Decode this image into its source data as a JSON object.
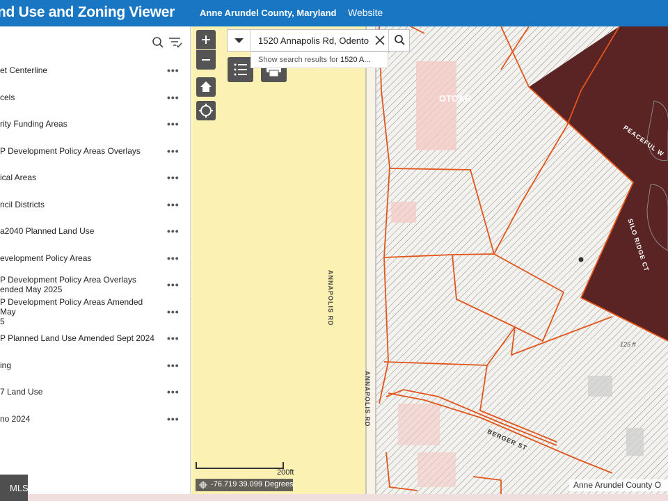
{
  "header": {
    "title": "nd Use and Zoning Viewer",
    "county": "Anne Arundel County, Maryland",
    "website": "Website"
  },
  "layers": [
    {
      "label": "et Centerline"
    },
    {
      "label": "cels"
    },
    {
      "label": "rity Funding Areas"
    },
    {
      "label": "P Development Policy Areas Overlays"
    },
    {
      "label": "ical Areas"
    },
    {
      "label": "ncil Districts"
    },
    {
      "label": "a2040 Planned Land Use"
    },
    {
      "label": "evelopment Policy Areas"
    },
    {
      "label": "P Development Policy Area Overlays\nended May 2025"
    },
    {
      "label": "P Development Policy Areas Amended May\n5"
    },
    {
      "label": "P Planned Land Use Amended Sept 2024"
    },
    {
      "label": "ing"
    },
    {
      "label": "7 Land Use"
    },
    {
      "label": "no 2024"
    }
  ],
  "more_label": "•••",
  "search": {
    "value": "1520 Annapolis Rd, Odento",
    "suggest_prefix": "Show search results for ",
    "suggest_term": "1520 A..."
  },
  "map": {
    "road_labels": [
      "ANNAPOLIS RD",
      "ANNAPOLIS RD",
      "BERGER ST",
      "SILO RIDGE CT",
      "PEACEFUL W"
    ],
    "dimension_label": "125 ft",
    "building_label": "OTCAR"
  },
  "scale_label": "200ft",
  "coordinates": "-76.719 39.099 Degrees",
  "attribution": "Anne Arundel County O",
  "mls_badge": "MLS",
  "colors": {
    "header": "#1876c3",
    "parcel_line": "#e2561c",
    "yellow_zone": "#fbf1b3",
    "dark_zone": "#5a2424"
  }
}
